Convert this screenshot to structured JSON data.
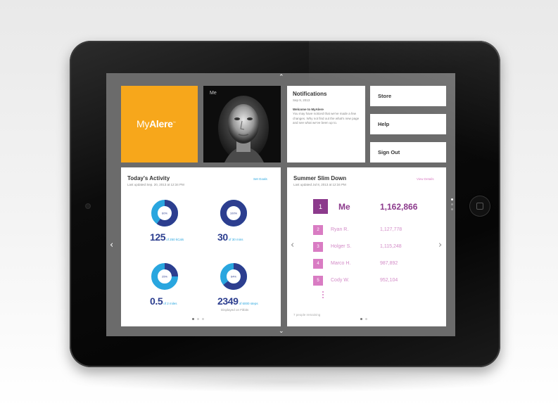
{
  "tiles": {
    "logo": {
      "prefix": "My",
      "brand": "Alere",
      "tm": "™"
    },
    "photo_label": "Me",
    "notifications": {
      "title": "Notifications",
      "date": "Sep 9, 2013",
      "item_title": "Welcome to MyAlere",
      "item_body": "You may have noticed that we've made a few changes. Why not find out the what's new page and see what we've been up to."
    },
    "buttons": [
      "Store",
      "Help",
      "Sign Out"
    ]
  },
  "activity": {
    "title": "Today's Activity",
    "updated": "Last updated Sep. 20, 2013 at 12:34 PM",
    "link": "Set Goals",
    "stats": [
      {
        "percent": 60,
        "percent_label": "60%",
        "value": "125",
        "unit": "of 250 kCals",
        "sub": ""
      },
      {
        "percent": 100,
        "percent_label": "100%",
        "value": "30",
        "unit": "of 30 mins",
        "sub": ""
      },
      {
        "percent": 25,
        "percent_label": "25%",
        "value": "0.5",
        "unit": "of 2 miles",
        "sub": ""
      },
      {
        "percent": 64,
        "percent_label": "64%",
        "value": "2349",
        "unit": "of 6000 steps",
        "sub": "Displayed on Fitbits"
      }
    ],
    "page_count": 3,
    "current_page": 1
  },
  "challenge": {
    "title": "Summer Slim Down",
    "updated": "Last updated Jul 8, 2013 at 12:34 PM",
    "link": "View Details",
    "leaders": [
      {
        "rank": "1",
        "name": "Me",
        "score": "1,162,866"
      },
      {
        "rank": "2",
        "name": "Ryan R.",
        "score": "1,127,778"
      },
      {
        "rank": "3",
        "name": "Holger S.",
        "score": "1,115,248"
      },
      {
        "rank": "4",
        "name": "Marco H.",
        "score": "987,892"
      },
      {
        "rank": "5",
        "name": "Cody W.",
        "score": "952,104"
      }
    ],
    "remaining": "7 people remaining",
    "page_count": 2,
    "current_page": 1
  },
  "screen_pages": {
    "count": 3,
    "current": 1
  },
  "colors": {
    "brand_orange": "#f7a71b",
    "activity_blue": "#2c3e8f",
    "activity_cyan": "#29a6df",
    "challenge_purple": "#8c3a8c",
    "challenge_pink": "#d97cc3",
    "screen_bg": "#6b6b6b"
  },
  "icons": {
    "scroll_up": "chevron-up-icon",
    "scroll_down": "chevron-down-icon",
    "prev": "chevron-left-icon",
    "next": "chevron-right-icon"
  }
}
